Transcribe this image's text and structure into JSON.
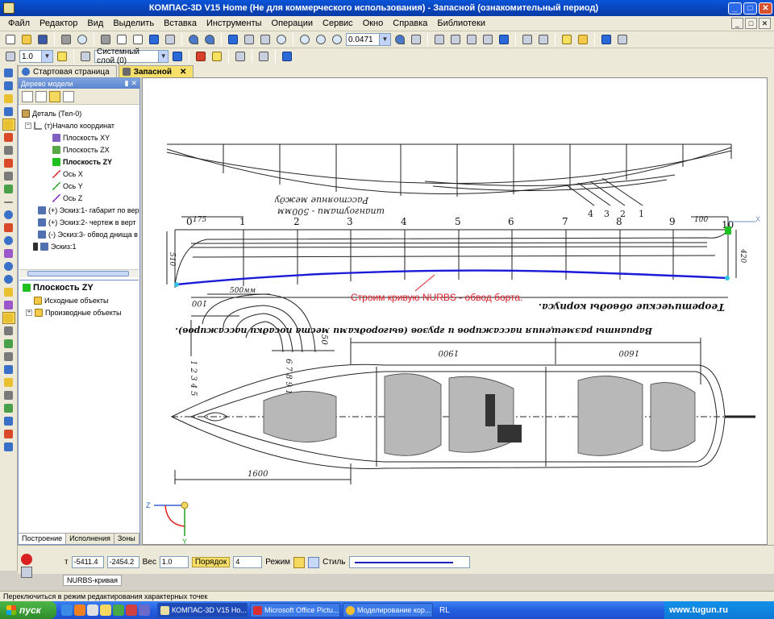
{
  "window": {
    "title": "КОМПАС-3D V15 Home (Не для коммерческого использования) - Запасной (ознакомительный период)",
    "minimize": "_",
    "maximize": "□",
    "close": "✕"
  },
  "menu": [
    "Файл",
    "Редактор",
    "Вид",
    "Выделить",
    "Вставка",
    "Инструменты",
    "Операции",
    "Сервис",
    "Окно",
    "Справка",
    "Библиотеки"
  ],
  "toolbar": {
    "zoom_value": "0.0471",
    "line_width": "1.0",
    "layer": "Системный слой (0)"
  },
  "tabs": [
    {
      "label": "Стартовая страница",
      "active": false
    },
    {
      "label": "Запасной",
      "active": true,
      "close": "✕"
    }
  ],
  "model_tree": {
    "header": "Дерево модели",
    "items": [
      {
        "label": "Деталь (Тел-0)"
      },
      {
        "label": "(т)Начало координат"
      },
      {
        "label": "Плоскость XY"
      },
      {
        "label": "Плоскость ZX"
      },
      {
        "label": "Плоскость ZY"
      },
      {
        "label": "Ось X"
      },
      {
        "label": "Ось Y"
      },
      {
        "label": "Ось Z"
      },
      {
        "label": "(+) Эскиз:1- габарит по вер"
      },
      {
        "label": "(+) Эскиз:2- чертеж в верт"
      },
      {
        "label": "(-) Эскиз:3- обвод днища в"
      },
      {
        "label": "Эскиз:1"
      }
    ],
    "props_title": "Плоскость ZY",
    "props_items": [
      "Исходные объекты",
      "Производные объекты"
    ],
    "tabs": [
      "Построение",
      "Исполнения",
      "Зоны"
    ]
  },
  "canvas": {
    "annotation": "Строим кривую NURBS - обвод борта.",
    "label_spacing_line1": "Расстояние между",
    "label_spacing_line2": "шпангоутами - 500мм",
    "station_numbers": [
      "0",
      "1",
      "2",
      "3",
      "4",
      "5",
      "6",
      "7",
      "8",
      "9",
      "10"
    ],
    "callouts": [
      "4",
      "3",
      "2",
      "1"
    ],
    "dim_left": "510",
    "dim_right": "420",
    "dim_top_left": "175",
    "dim_top_right": "100",
    "dim_bottom": "500мм",
    "title_lines": "Теоретические обводы корпуса.",
    "title_variants": "Варианты размещения пассажиров и грузов (выгородками места посадки пассажиров).",
    "dim_1900": "1900",
    "dim_1600_top": "1600",
    "dim_1600_bottom": "1600",
    "dim_100": "100",
    "dim_50": "50",
    "section_left_numbers": "1 2 3 4 5",
    "section_right_numbers": "6 7 8 9 10",
    "axis_z": "Z",
    "axis_y": "Y",
    "axis_x": "X"
  },
  "property_bar": {
    "coord_label": "т",
    "x": "-5411.4",
    "y": "-2454.2",
    "weight_label": "Вес",
    "weight": "1.0",
    "order_label": "Порядок",
    "order": "4",
    "mode_label": "Режим",
    "style_label": "Стиль",
    "object_tab": "NURBS-кривая"
  },
  "status": "Переключиться в режим редактирования характерных точек",
  "taskbar": {
    "start": "пуск",
    "tasks": [
      {
        "label": "КОМПАС-3D V15 Ho...",
        "active": true
      },
      {
        "label": "Microsoft Office Pictu...",
        "active": false
      },
      {
        "label": "Моделирование кор...",
        "active": false
      }
    ],
    "lang": "RL",
    "watermark": "www.tugun.ru"
  },
  "colors": {
    "nurbs_curve": "#1a1ad8",
    "annotation": "#e0202a",
    "accent_tab": "#f7e06a"
  }
}
